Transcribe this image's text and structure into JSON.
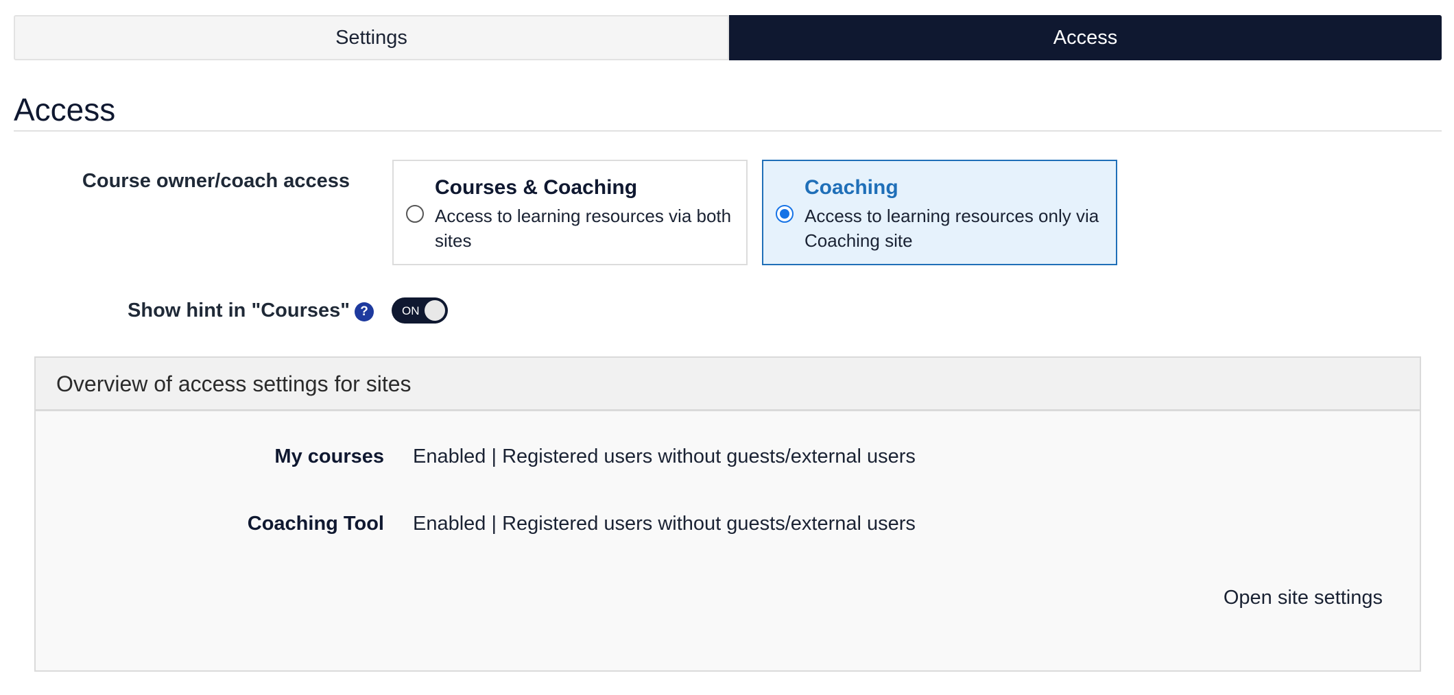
{
  "tabs": [
    {
      "label": "Settings",
      "active": false
    },
    {
      "label": "Access",
      "active": true
    }
  ],
  "page": {
    "title": "Access"
  },
  "owner_access": {
    "label": "Course owner/coach access",
    "options": [
      {
        "title": "Courses & Coaching",
        "description": "Access to learning resources via both sites",
        "selected": false
      },
      {
        "title": "Coaching",
        "description": "Access to learning resources only via Coaching site",
        "selected": true
      }
    ]
  },
  "hint": {
    "label": "Show hint in \"Courses\"",
    "help_icon": "?",
    "toggle_label": "ON",
    "toggle_on": true
  },
  "overview": {
    "title": "Overview of access settings for sites",
    "rows": [
      {
        "label": "My courses",
        "value": "Enabled | Registered users without guests/external users"
      },
      {
        "label": "Coaching Tool",
        "value": "Enabled | Registered users without guests/external users"
      }
    ],
    "link_label": "Open site settings"
  },
  "colors": {
    "navy": "#0f1830",
    "accent_blue": "#1f6fb8",
    "selected_bg": "#e6f2fc",
    "radio_blue": "#1673e6",
    "help_icon_bg": "#1e3a9e"
  }
}
